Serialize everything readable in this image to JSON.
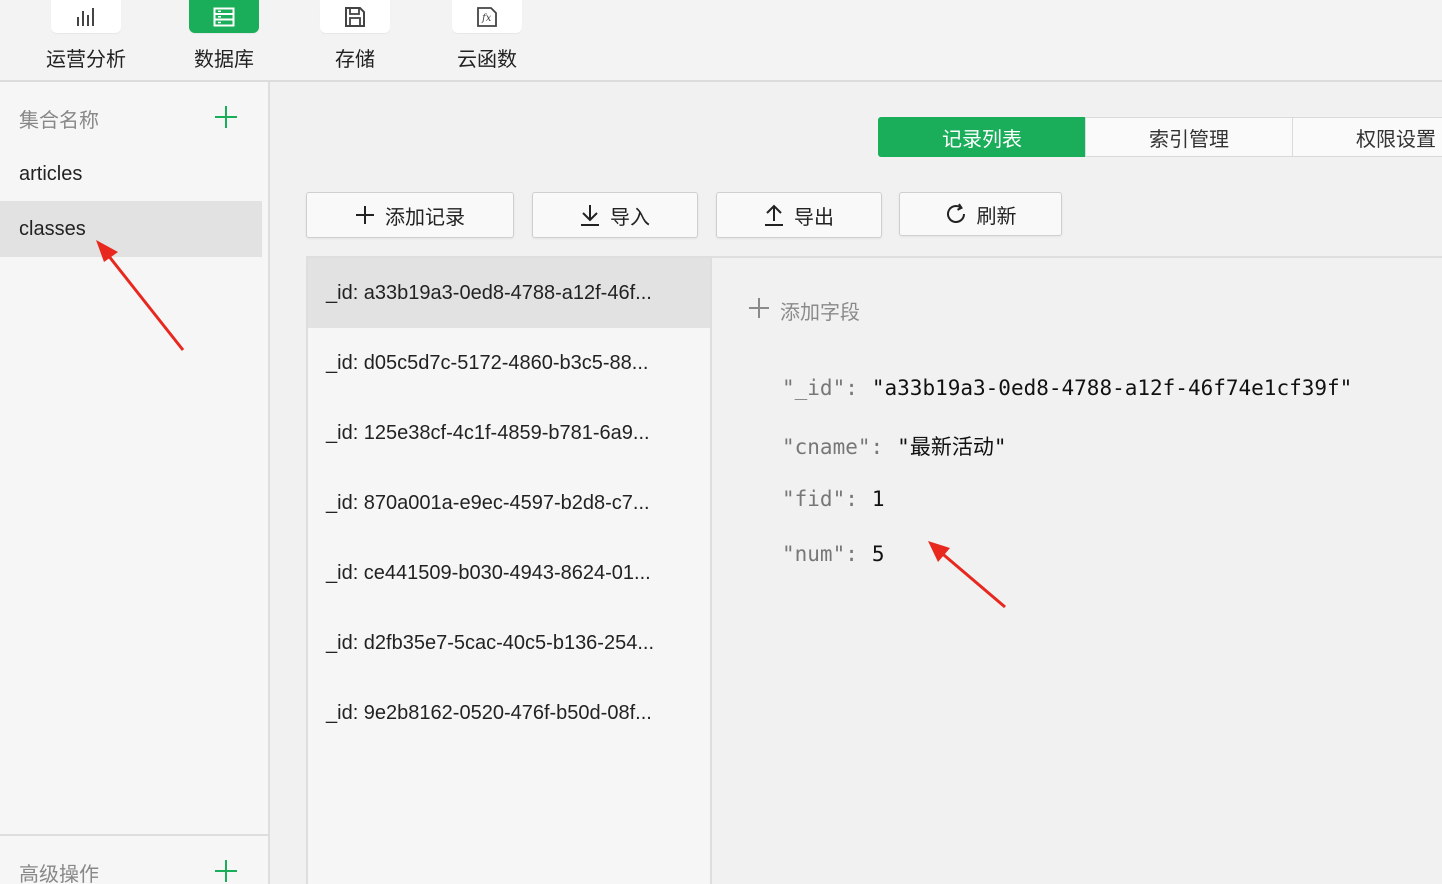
{
  "toolbar": {
    "items": [
      {
        "label": "运营分析",
        "icon": "bar-chart-icon"
      },
      {
        "label": "数据库",
        "icon": "database-icon"
      },
      {
        "label": "存储",
        "icon": "save-icon"
      },
      {
        "label": "云函数",
        "icon": "function-icon"
      }
    ],
    "active_index": 1,
    "accent_color": "#1aad5a"
  },
  "sidebar": {
    "header": "集合名称",
    "collections": [
      "articles",
      "classes"
    ],
    "selected": "classes",
    "footer": "高级操作"
  },
  "tabs": [
    "记录列表",
    "索引管理",
    "权限设置"
  ],
  "actions": {
    "add_record": "添加记录",
    "import": "导入",
    "export": "导出",
    "refresh": "刷新"
  },
  "records": [
    "_id: a33b19a3-0ed8-4788-a12f-46f...",
    "_id: d05c5d7c-5172-4860-b3c5-88...",
    "_id: 125e38cf-4c1f-4859-b781-6a9...",
    "_id: 870a001a-e9ec-4597-b2d8-c7...",
    "_id: ce441509-b030-4943-8624-01...",
    "_id: d2fb35e7-5cac-40c5-b136-254...",
    "_id: 9e2b8162-0520-476f-b50d-08f..."
  ],
  "detail": {
    "add_field": "添加字段",
    "fields": [
      {
        "key": "\"_id\"",
        "value": "\"a33b19a3-0ed8-4788-a12f-46f74e1cf39f\""
      },
      {
        "key": "\"cname\"",
        "value": "\"最新活动\""
      },
      {
        "key": "\"fid\"",
        "value": "1"
      },
      {
        "key": "\"num\"",
        "value": "5"
      }
    ]
  }
}
